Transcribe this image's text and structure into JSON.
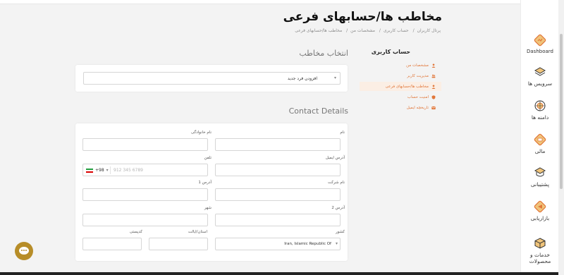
{
  "header": {
    "title": "مخاطب ها/حسابهای فرعی",
    "breadcrumb": [
      "پرتال کاربران",
      "حساب کاربری",
      "مشخصات من",
      "مخاطب ها/حسابهای فرعی"
    ]
  },
  "contact_select": {
    "section_title": "انتخاب مخاطب",
    "selected": "افزودن فرد جدید"
  },
  "contact_details": {
    "section_title": "Contact Details",
    "labels": {
      "first_name": "نام",
      "last_name": "نام خانوادگی",
      "email": "آدرس ایمیل",
      "phone": "تلفن",
      "company": "نام شرکت",
      "address1": "آدرس 1",
      "address2": "آدرس 2",
      "city": "شهر",
      "country": "کشور",
      "state": "استان/ایالت",
      "postcode": "کدپستی"
    },
    "phone_code": "+98",
    "phone_placeholder": "912 345 6789",
    "country_value": "Iran, Islamic Republic Of"
  },
  "account_menu": {
    "title": "حساب کاربری",
    "items": [
      {
        "label": "مشخصات من",
        "active": false
      },
      {
        "label": "مدیریت کاربر",
        "active": false
      },
      {
        "label": "مخاطب ها/حسابهای فرعی",
        "active": true
      },
      {
        "label": "امنیت حساب",
        "active": false
      },
      {
        "label": "تاریخچه ایمیل",
        "active": false
      }
    ]
  },
  "sidebar": {
    "items": [
      {
        "label": "Dashboard",
        "icon": "dashboard-icon"
      },
      {
        "label": "سرویس ها",
        "icon": "layers-icon"
      },
      {
        "label": "دامنه ها",
        "icon": "globe-icon"
      },
      {
        "label": "مالی",
        "icon": "wallet-icon"
      },
      {
        "label": "پشتیبانی",
        "icon": "support-icon"
      },
      {
        "label": "بازاریابی",
        "icon": "marketing-icon"
      },
      {
        "label": "خدمات و محصولات",
        "icon": "box-icon"
      }
    ]
  },
  "colors": {
    "accent": "#e1773a",
    "brand": "#c0392b",
    "chat": "#b78d28"
  }
}
